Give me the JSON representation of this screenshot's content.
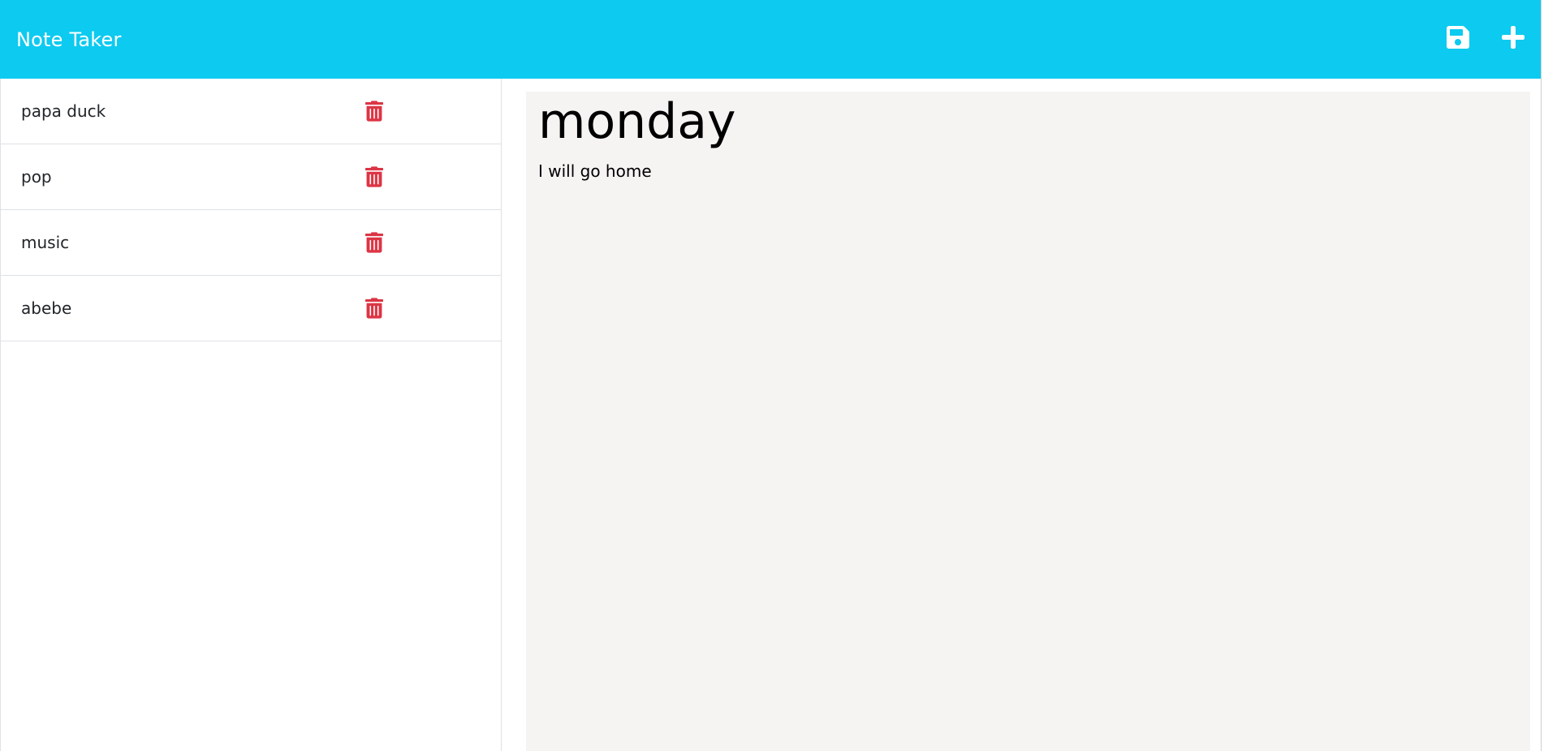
{
  "app": {
    "title": "Note Taker"
  },
  "colors": {
    "navbar": "#0dcaf0",
    "trash": "#dc3545",
    "editor_bg": "#f6f3f3"
  },
  "toolbar": {
    "save_icon": "floppy-disk-icon",
    "new_icon": "plus-icon"
  },
  "notes": [
    {
      "title": "papa duck",
      "icon": "trash-icon"
    },
    {
      "title": "pop",
      "icon": "trash-icon"
    },
    {
      "title": "music",
      "icon": "trash-icon"
    },
    {
      "title": "abebe",
      "icon": "trash-icon"
    }
  ],
  "editor": {
    "title": "monday",
    "text": "I will go home"
  }
}
